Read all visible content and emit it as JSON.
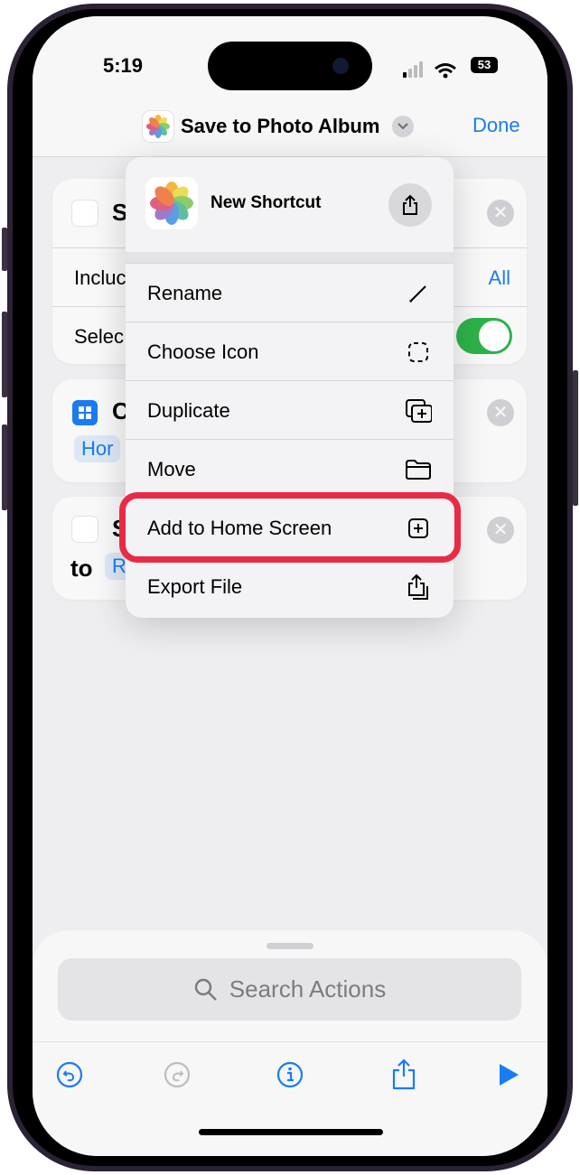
{
  "status_bar": {
    "time": "5:19",
    "battery": "53"
  },
  "nav": {
    "title": "Save to Photo Album",
    "done_label": "Done"
  },
  "background_cards": {
    "card1": {
      "title_partial": "S",
      "row1_label": "Incluc",
      "row1_value": "All",
      "row2_label": "Selec",
      "toggle_on": true
    },
    "card2": {
      "title_partial": "C",
      "pill": "Hor"
    },
    "card3": {
      "title_partial": "S",
      "prefix": "to",
      "pill": "R"
    }
  },
  "menu": {
    "shortcut_name": "New Shortcut",
    "items": [
      {
        "label": "Rename",
        "icon": "pencil-icon"
      },
      {
        "label": "Choose Icon",
        "icon": "dashed-square-icon"
      },
      {
        "label": "Duplicate",
        "icon": "duplicate-icon"
      },
      {
        "label": "Move",
        "icon": "folder-icon"
      },
      {
        "label": "Add to Home Screen",
        "icon": "plus-square-icon",
        "highlighted": true
      },
      {
        "label": "Export File",
        "icon": "export-icon"
      }
    ]
  },
  "search": {
    "placeholder": "Search Actions"
  },
  "toolbar": {
    "items": [
      "undo",
      "redo",
      "info",
      "share",
      "run"
    ]
  },
  "colors": {
    "accent": "#1a7cf0",
    "highlight": "#ea2a45",
    "toggle": "#2db24a"
  }
}
